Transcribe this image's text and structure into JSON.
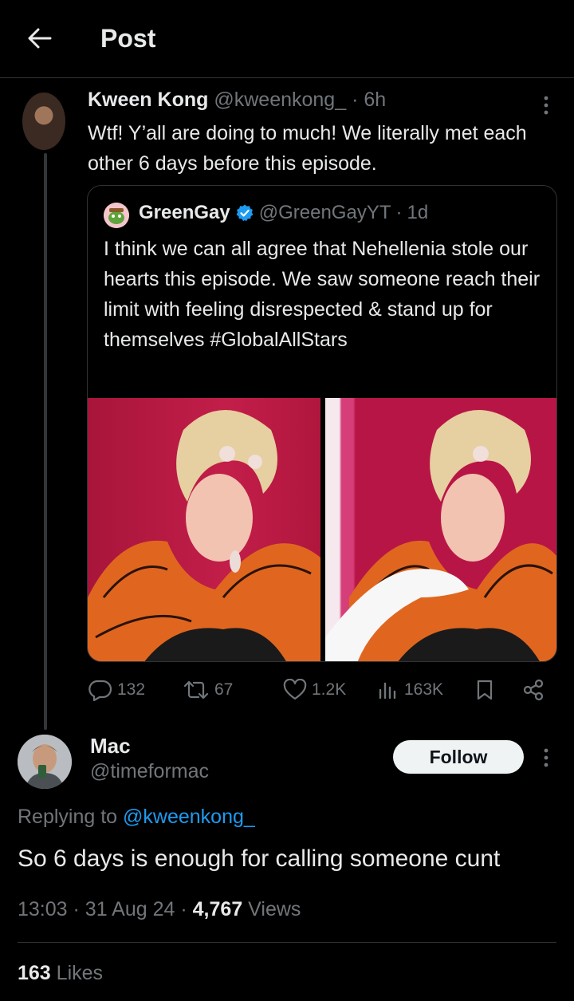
{
  "header": {
    "title": "Post",
    "back_icon": "arrow-left-icon"
  },
  "tweet": {
    "name": "Kween Kong",
    "handle": "@kweenkong_",
    "sep": "·",
    "time": "6h",
    "text": "Wtf! Y’all are doing to much! We literally met each other 6 days before this episode.",
    "quote": {
      "name": "GreenGay",
      "verified_icon": "verified-badge-icon",
      "handle": "@GreenGayYT",
      "sep": "·",
      "time": "1d",
      "text": "I think we can all agree that Nehellenia stole our hearts this episode. We saw someone reach their limit with feeling disrespected & stand up for themselves #GlobalAllStars"
    },
    "actions": {
      "replies": "132",
      "reposts": "67",
      "likes": "1.2K",
      "views": "163K"
    }
  },
  "reply": {
    "name": "Mac",
    "handle": "@timeformac",
    "follow_label": "Follow",
    "replying_prefix": "Replying to ",
    "replying_handle": "@kweenkong_",
    "text": "So 6 days is enough for calling someone cunt",
    "time": "13:03",
    "sep1": "·",
    "date": "31 Aug 24",
    "sep2": "·",
    "views_count": "4,767",
    "views_label": " Views",
    "likes_count": "163",
    "likes_label": " Likes"
  },
  "colors": {
    "background": "#000000",
    "text": "#e7e9ea",
    "muted": "#71767b",
    "link": "#1d9bf0",
    "border": "#2f3336"
  }
}
